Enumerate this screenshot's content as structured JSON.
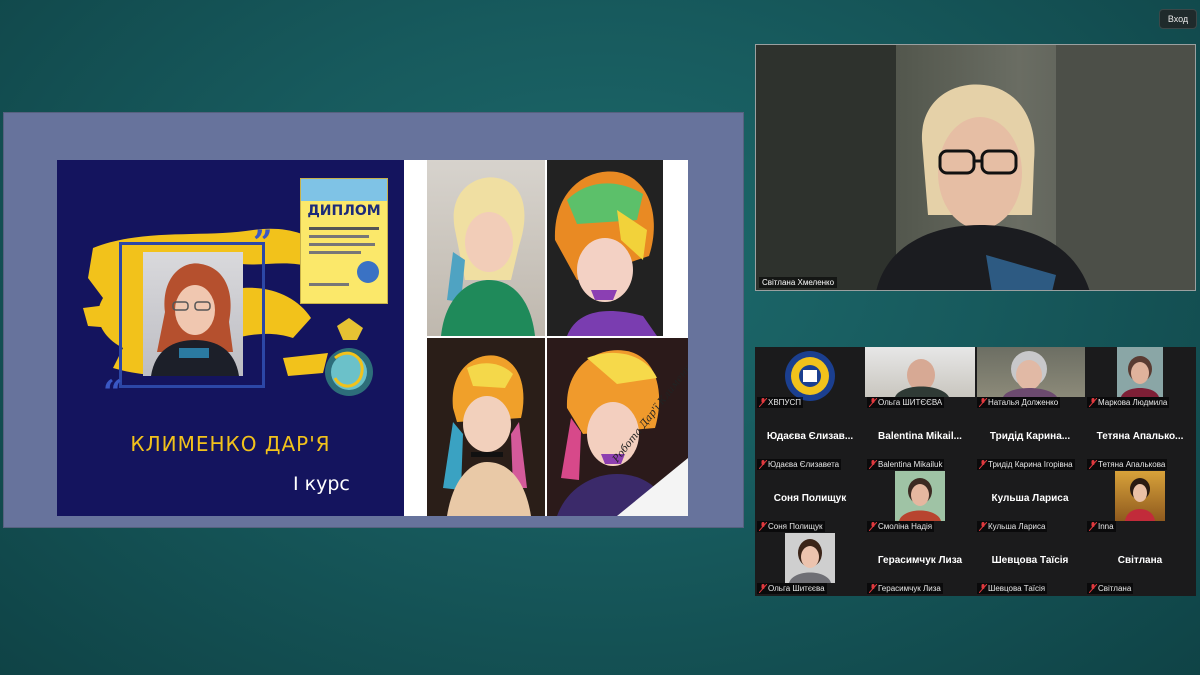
{
  "header": {
    "exit_label": "Вход"
  },
  "slide": {
    "student_name": "КЛИМЕНКО ДАР'Я",
    "course": "І курс",
    "diploma_title": "ДИПЛОМ",
    "signature": "Робота Дар'ї Клименко"
  },
  "speaker": {
    "name": "Світлана Хмеленко"
  },
  "participants": [
    {
      "label": "ХВПУСП",
      "big": "",
      "type": "logo"
    },
    {
      "label": "Ольга ШИТЄЄВА",
      "big": "",
      "type": "video"
    },
    {
      "label": "Наталья Долженко",
      "big": "",
      "type": "video"
    },
    {
      "label": "Маркова Людмила",
      "big": "",
      "type": "video"
    },
    {
      "label": "Юдаєва Єлизавета",
      "big": "Юдаєва Єлизав...",
      "type": "name"
    },
    {
      "label": "Balentina Mikailuk",
      "big": "Balentina Mikail...",
      "type": "name"
    },
    {
      "label": "Тридід Карина Ігорівна",
      "big": "Тридід Карина...",
      "type": "name"
    },
    {
      "label": "Тетяна Апалькова",
      "big": "Тетяна Апалько...",
      "type": "name"
    },
    {
      "label": "Соня Полищук",
      "big": "Соня Полищук",
      "type": "name"
    },
    {
      "label": "Смоліна Надія",
      "big": "",
      "type": "video"
    },
    {
      "label": "Кульша Лариса",
      "big": "Кульша Лариса",
      "type": "name"
    },
    {
      "label": "Inna",
      "big": "",
      "type": "video"
    },
    {
      "label": "Ольга Шитєєва",
      "big": "",
      "type": "video"
    },
    {
      "label": "Герасимчук Лиза",
      "big": "Герасимчук Лиза",
      "type": "name"
    },
    {
      "label": "Шевцова Таїсія",
      "big": "Шевцова Таїсія",
      "type": "name"
    },
    {
      "label": "Світлана",
      "big": "Світлана",
      "type": "name"
    }
  ],
  "colors": {
    "accent_yellow": "#f2c21b",
    "slide_navy": "#14145e",
    "mic_muted": "#e0393e"
  }
}
